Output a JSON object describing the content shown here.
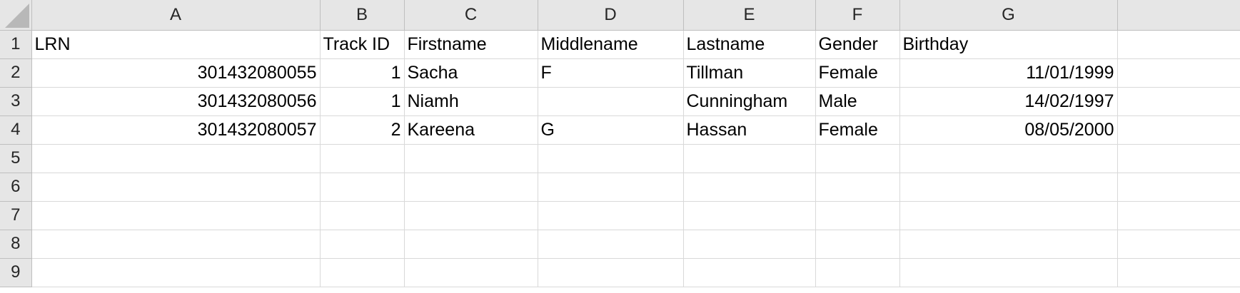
{
  "columns": [
    "A",
    "B",
    "C",
    "D",
    "E",
    "F",
    "G"
  ],
  "row_numbers": [
    "1",
    "2",
    "3",
    "4",
    "5",
    "6",
    "7",
    "8",
    "9"
  ],
  "headers": {
    "lrn": "LRN",
    "track_id": "Track ID",
    "firstname": "Firstname",
    "middlename": "Middlename",
    "lastname": "Lastname",
    "gender": "Gender",
    "birthday": "Birthday"
  },
  "rows": [
    {
      "lrn": "301432080055",
      "track_id": "1",
      "firstname": "Sacha",
      "middlename": "F",
      "lastname": "Tillman",
      "gender": "Female",
      "birthday": "11/01/1999"
    },
    {
      "lrn": "301432080056",
      "track_id": "1",
      "firstname": "Niamh",
      "middlename": "",
      "lastname": "Cunningham",
      "gender": "Male",
      "birthday": "14/02/1997"
    },
    {
      "lrn": "301432080057",
      "track_id": "2",
      "firstname": "Kareena",
      "middlename": "G",
      "lastname": "Hassan",
      "gender": "Female",
      "birthday": "08/05/2000"
    }
  ]
}
